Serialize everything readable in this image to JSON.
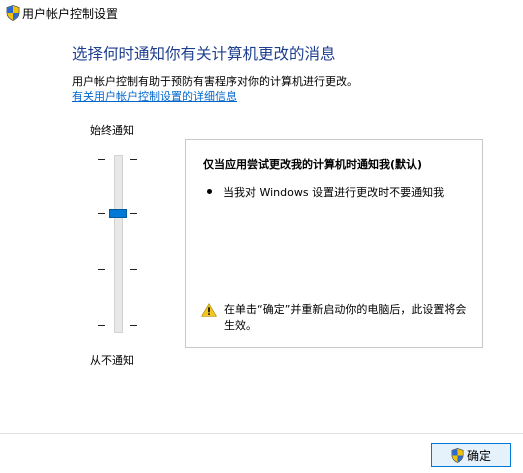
{
  "window": {
    "title": "用户帐户控制设置"
  },
  "main": {
    "heading": "选择何时通知你有关计算机更改的消息",
    "description": "用户帐户控制有助于预防有害程序对你的计算机进行更改。",
    "link": "有关用户帐户控制设置的详细信息"
  },
  "slider": {
    "top_label": "始终通知",
    "bottom_label": "从不通知",
    "levels": 4,
    "selected_level": 3,
    "accent_color": "#0078d7"
  },
  "info": {
    "title": "仅当应用尝试更改我的计算机时通知我(默认)",
    "bullet": "当我对 Windows 设置进行更改时不要通知我",
    "warning": "在单击“确定”并重新启动你的电脑后，此设置将会生效。",
    "warning_icon": "warning-icon"
  },
  "footer": {
    "ok_label": "确定",
    "ok_icon": "uac-shield-icon"
  }
}
